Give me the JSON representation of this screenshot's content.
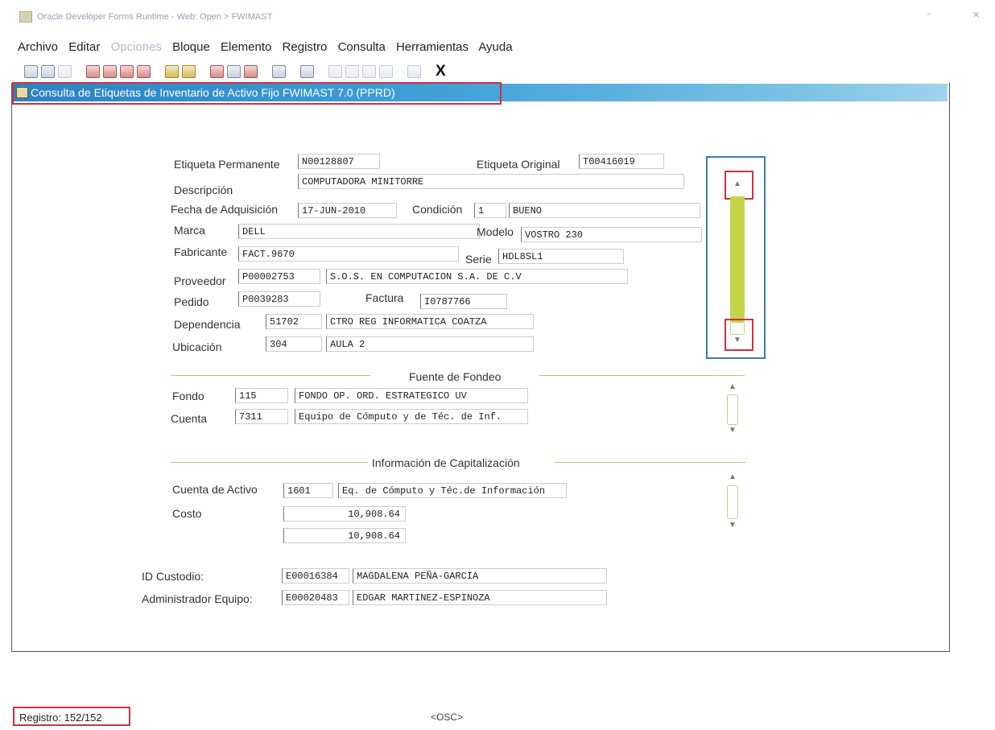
{
  "app": {
    "title": "Oracle Developer Forms Runtime - Web: Open > FWIMAST"
  },
  "menu": [
    {
      "label": "Archivo",
      "dim": false
    },
    {
      "label": "Editar",
      "dim": false
    },
    {
      "label": "Opciones",
      "dim": true
    },
    {
      "label": "Bloque",
      "dim": false
    },
    {
      "label": "Elemento",
      "dim": false
    },
    {
      "label": "Registro",
      "dim": false
    },
    {
      "label": "Consulta",
      "dim": false
    },
    {
      "label": "Herramientas",
      "dim": false
    },
    {
      "label": "Ayuda",
      "dim": false
    }
  ],
  "toolbar": {
    "exit_label": "X"
  },
  "form": {
    "title": "Consulta de Etiquetas de Inventario de Activo Fijo  FWIMAST  7.0  (PPRD)"
  },
  "labels": {
    "etiqueta_permanente": "Etiqueta Permanente",
    "etiqueta_original": "Etiqueta Original",
    "descripcion": "Descripción",
    "fecha_adquisicion": "Fecha de Adquisición",
    "condicion": "Condición",
    "marca": "Marca",
    "modelo": "Modelo",
    "fabricante": "Fabricante",
    "serie": "Serie",
    "proveedor": "Proveedor",
    "pedido": "Pedido",
    "factura": "Factura",
    "dependencia": "Dependencia",
    "ubicacion": "Ubicación",
    "fondo": "Fondo",
    "cuenta": "Cuenta",
    "cuenta_activo": "Cuenta de Activo",
    "costo": "Costo",
    "id_custodio": "ID Custodio:",
    "admin_equipo": "Administrador Equipo:"
  },
  "values": {
    "etiqueta_permanente": "N00128807",
    "etiqueta_original": "T00416019",
    "descripcion": "COMPUTADORA MINITORRE",
    "fecha_adquisicion": "17-JUN-2010",
    "condicion_code": "1",
    "condicion_desc": "BUENO",
    "marca": "DELL",
    "modelo": "VOSTRO 230",
    "fabricante": "FACT.9670",
    "serie": "HDL8SL1",
    "proveedor_code": "P00002753",
    "proveedor_name": "S.O.S. EN COMPUTACION S.A. DE C.V",
    "pedido": "P0039283",
    "factura": "I0787766",
    "dependencia_code": "51702",
    "dependencia_name": "CTRO REG INFORMATICA COATZA",
    "ubicacion_code": "304",
    "ubicacion_name": "AULA  2",
    "fondo_code": "115",
    "fondo_name": "FONDO OP. ORD. ESTRATEGICO UV",
    "cuenta_code": "7311",
    "cuenta_name": "Equipo de Cómputo y de Téc. de Inf.",
    "cuenta_activo_code": "1601",
    "cuenta_activo_name": "Eq. de Cómputo y Téc.de Información",
    "costo_1": "10,908.64",
    "costo_2": "10,908.64",
    "custodio_id": "E00016384",
    "custodio_name": "MAGDALENA PEÑA-GARCIA",
    "admin_id": "E00020483",
    "admin_name": "EDGAR MARTINEZ-ESPINOZA"
  },
  "sections": {
    "fuente": "Fuente de  Fondeo",
    "capitalizacion": "Información de Capitalización"
  },
  "status": {
    "registro": "Registro: 152/152",
    "osc": "<OSC>"
  },
  "colors": {
    "accent_title": "#2a82c4",
    "highlight_box": "#d03040",
    "scroll_box": "#3a7ac0",
    "scroll_thumb": "#c4d44a"
  }
}
